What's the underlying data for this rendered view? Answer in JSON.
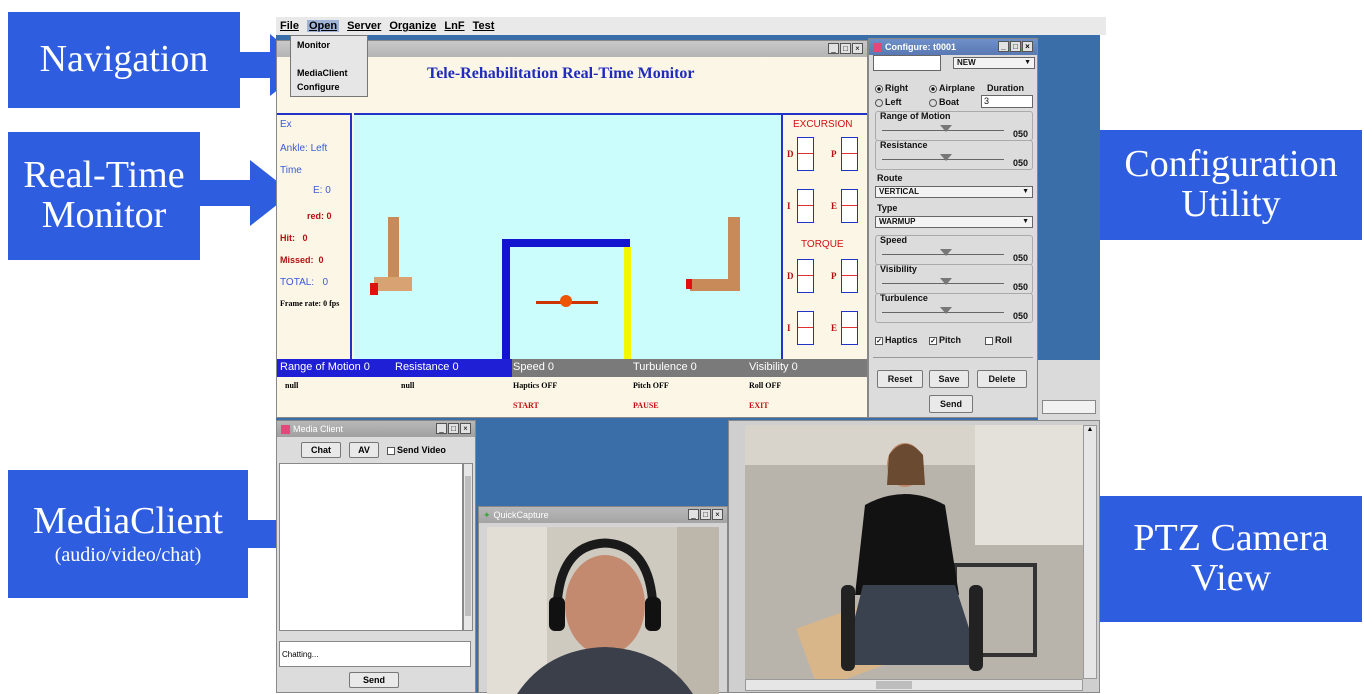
{
  "menubar": {
    "items": [
      "File",
      "Open",
      "Server",
      "Organize",
      "LnF",
      "Test"
    ]
  },
  "open_menu": {
    "items": [
      "Monitor",
      "MediaClient",
      "Configure"
    ]
  },
  "callouts": {
    "navigation": "Navigation",
    "realtime_line1": "Real-Time",
    "realtime_line2": "Monitor",
    "config_line1": "Configuration",
    "config_line2": "Utility",
    "media_line1": "MediaClient",
    "media_line2": "(audio/video/chat)",
    "ptz_line1": "PTZ Camera",
    "ptz_line2": "View"
  },
  "monitor": {
    "title": "Tele-Rehabilitation Real-Time Monitor",
    "left": {
      "ex": "Ex",
      "ankle": "Ankle: Left",
      "time": "Time",
      "score": "E: 0",
      "fired": "red: 0",
      "hit_label": "Hit:",
      "hit_val": "0",
      "missed_label": "Missed:",
      "missed_val": "0",
      "total": "TOTAL:",
      "total_val": "0",
      "frame": "Frame rate: 0 fps"
    },
    "excursion": "EXCURSION",
    "torque": "TORQUE",
    "gauge_labels": {
      "d": "D",
      "p": "P",
      "i": "I",
      "e": "E"
    },
    "status": {
      "rom": "Range of Motion 0",
      "resistance": "Resistance 0",
      "speed": "Speed 0",
      "turbulence": "Turbulence 0",
      "visibility": "Visibility 0"
    },
    "row2": {
      "null1": "null",
      "null2": "null",
      "haptics": "Haptics OFF",
      "pitch": "Pitch OFF",
      "roll": "Roll OFF"
    },
    "row3": {
      "start": "START",
      "pause": "PAUSE",
      "exit": "EXIT"
    }
  },
  "config": {
    "title": "Configure: t0001",
    "new": "NEW",
    "right": "Right",
    "left": "Left",
    "airplane": "Airplane",
    "boat": "Boat",
    "duration": "Duration",
    "duration_val": "3",
    "rom": "Range of Motion",
    "resistance": "Resistance",
    "route": "Route",
    "route_val": "VERTICAL",
    "type": "Type",
    "type_val": "WARMUP",
    "speed": "Speed",
    "visibility": "Visibility",
    "turbulence": "Turbulence",
    "slider_val": "050",
    "haptics": "Haptics",
    "pitch": "Pitch",
    "roll": "Roll",
    "reset": "Reset",
    "save": "Save",
    "delete": "Delete",
    "send": "Send"
  },
  "media": {
    "title": "Media Client",
    "chat": "Chat",
    "av": "AV",
    "send_video": "Send Video",
    "chatting": "Chatting...",
    "send": "Send"
  },
  "quickcapture": {
    "title": "QuickCapture"
  }
}
